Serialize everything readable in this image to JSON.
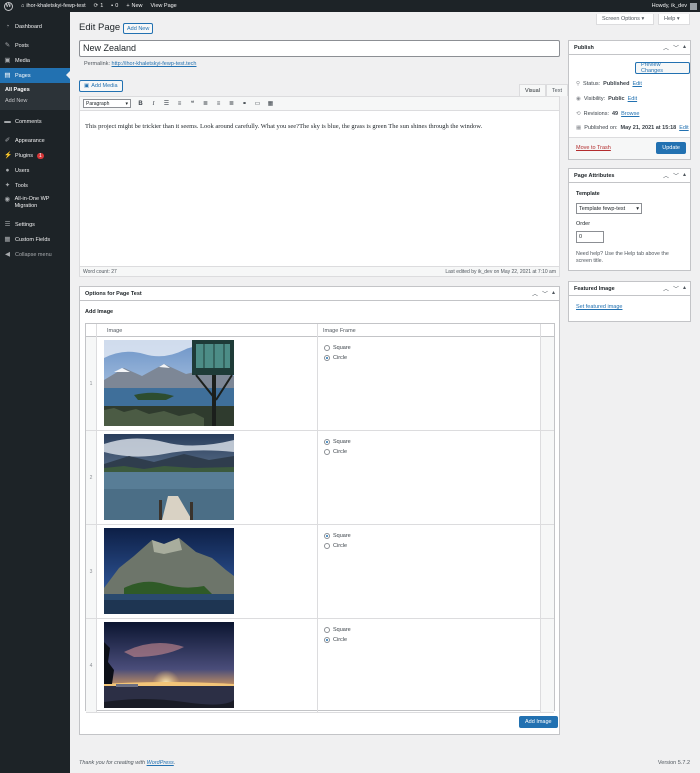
{
  "admin_bar": {
    "site_name": "ihor-khaletskyi-fewp-test",
    "updates_count": "1",
    "comments_count": "0",
    "new_label": "New",
    "view_page": "View Page",
    "howdy": "Howdy, ik_dev"
  },
  "sidebar": {
    "items": [
      {
        "label": "Dashboard",
        "icon": "dashboard-icon"
      },
      {
        "label": "Posts",
        "icon": "pin-icon"
      },
      {
        "label": "Media",
        "icon": "media-icon"
      },
      {
        "label": "Pages",
        "icon": "pages-icon"
      }
    ],
    "pages_sub": [
      "All Pages",
      "Add New"
    ],
    "items2": [
      {
        "label": "Comments",
        "icon": "comment-icon"
      },
      {
        "label": "Appearance",
        "icon": "brush-icon"
      },
      {
        "label": "Plugins",
        "icon": "plugin-icon",
        "badge": "1"
      },
      {
        "label": "Users",
        "icon": "user-icon"
      },
      {
        "label": "Tools",
        "icon": "wrench-icon"
      },
      {
        "label": "All-in-One WP Migration",
        "icon": "migration-icon"
      },
      {
        "label": "Settings",
        "icon": "settings-icon"
      },
      {
        "label": "Custom Fields",
        "icon": "fields-icon"
      },
      {
        "label": "Collapse menu",
        "icon": "collapse-icon"
      }
    ]
  },
  "header": {
    "screen_options": "Screen Options",
    "help": "Help",
    "title": "Edit Page",
    "add_new": "Add New"
  },
  "post": {
    "title": "New Zealand",
    "permalink_label": "Permalink:",
    "permalink_url": "http://ihor-khaletskyi-fewp-test.tech",
    "add_media": "Add Media",
    "tab_visual": "Visual",
    "tab_text": "Text",
    "format": "Paragraph",
    "content": "This project might be trickier than it seems. Look around carefully. What you see?The sky is blue, the grass is green The sun shines through the window.",
    "word_count": "Word count: 27",
    "last_edited": "Last edited by ik_dev on May 22, 2021 at 7:10 am"
  },
  "options_box": {
    "title": "Options for Page Test",
    "add_image_label": "Add Image",
    "col_image": "Image",
    "col_frame": "Image Frame",
    "square": "Square",
    "circle": "Circle",
    "rows": [
      {
        "index": "1",
        "selected": "Circle"
      },
      {
        "index": "2",
        "selected": "Square"
      },
      {
        "index": "3",
        "selected": "Square"
      },
      {
        "index": "4",
        "selected": "Circle"
      }
    ],
    "add_image_button": "Add Image"
  },
  "publish": {
    "title": "Publish",
    "preview": "Preview Changes",
    "status_label": "Status:",
    "status_value": "Published",
    "visibility_label": "Visibility:",
    "visibility_value": "Public",
    "revisions_label": "Revisions:",
    "revisions_value": "49",
    "browse": "Browse",
    "published_label": "Published on:",
    "published_value": "May 21, 2021 at 15:18",
    "edit": "Edit",
    "trash": "Move to Trash",
    "update": "Update"
  },
  "attributes": {
    "title": "Page Attributes",
    "template_label": "Template",
    "template_value": "Template fewp-test",
    "order_label": "Order",
    "order_value": "0",
    "help": "Need help? Use the Help tab above the screen title."
  },
  "featured": {
    "title": "Featured Image",
    "link": "Set featured image"
  },
  "footer": {
    "thanks": "Thank you for creating with",
    "wordpress": "WordPress",
    "version": "Version 5.7.2"
  },
  "colors": {
    "accent": "#2271b1",
    "sidebar_bg": "#1d2327",
    "trash": "#b32d2e"
  }
}
